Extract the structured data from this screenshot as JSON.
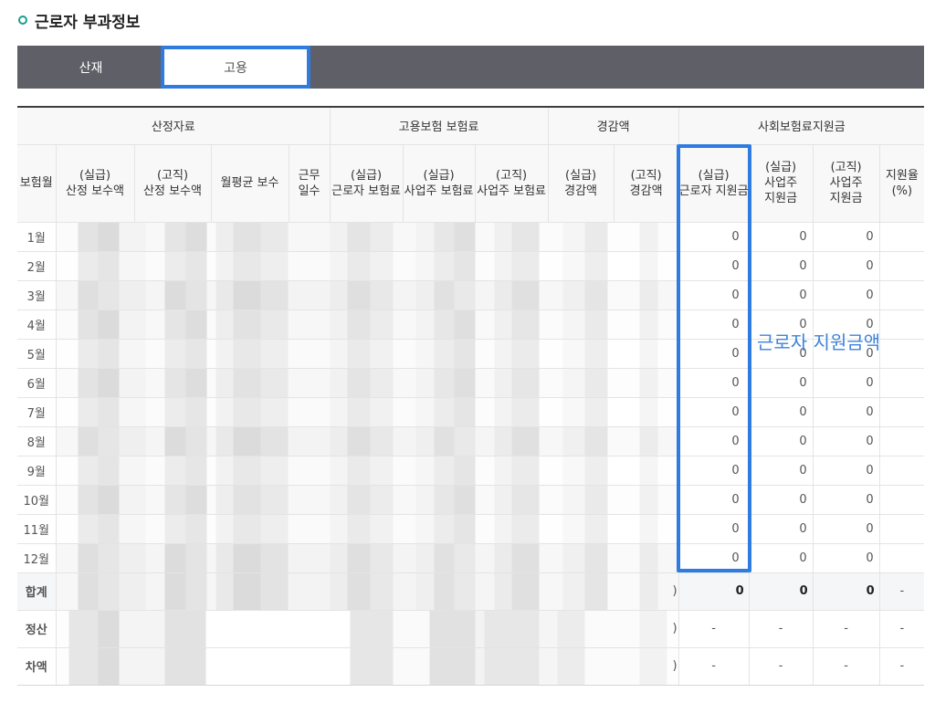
{
  "section": {
    "title": "근로자 부과정보"
  },
  "tabs": [
    {
      "label": "산재",
      "active": false
    },
    {
      "label": "고용",
      "active": true
    }
  ],
  "table": {
    "group_headers": [
      "산정자료",
      "고용보험 보험료",
      "경감액",
      "사회보험료지원금"
    ],
    "columns": [
      {
        "lines": [
          "보험월"
        ]
      },
      {
        "lines": [
          "(실급)",
          "산정 보수액"
        ]
      },
      {
        "lines": [
          "(고직)",
          "산정 보수액"
        ]
      },
      {
        "lines": [
          "월평균 보수"
        ]
      },
      {
        "lines": [
          "근무",
          "일수"
        ]
      },
      {
        "lines": [
          "(실급)",
          "근로자 보험료"
        ]
      },
      {
        "lines": [
          "(실급)",
          "사업주 보험료"
        ]
      },
      {
        "lines": [
          "(고직)",
          "사업주 보험료"
        ]
      },
      {
        "lines": [
          "(실급)",
          "경감액"
        ]
      },
      {
        "lines": [
          "(고직)",
          "경감액"
        ]
      },
      {
        "lines": [
          "(실급)",
          "근로자 지원금"
        ]
      },
      {
        "lines": [
          "(실급)",
          "사업주",
          "지원금"
        ]
      },
      {
        "lines": [
          "(고직)",
          "사업주",
          "지원금"
        ]
      },
      {
        "lines": [
          "지원율",
          "(%)"
        ]
      }
    ],
    "rows": [
      {
        "month": "1월",
        "worker_support": "0",
        "employer_support_silgeup": "0",
        "employer_support_gojik": "0",
        "support_rate": ""
      },
      {
        "month": "2월",
        "worker_support": "0",
        "employer_support_silgeup": "0",
        "employer_support_gojik": "0",
        "support_rate": ""
      },
      {
        "month": "3월",
        "worker_support": "0",
        "employer_support_silgeup": "0",
        "employer_support_gojik": "0",
        "support_rate": ""
      },
      {
        "month": "4월",
        "worker_support": "0",
        "employer_support_silgeup": "0",
        "employer_support_gojik": "0",
        "support_rate": ""
      },
      {
        "month": "5월",
        "worker_support": "0",
        "employer_support_silgeup": "0",
        "employer_support_gojik": "0",
        "support_rate": ""
      },
      {
        "month": "6월",
        "worker_support": "0",
        "employer_support_silgeup": "0",
        "employer_support_gojik": "0",
        "support_rate": ""
      },
      {
        "month": "7월",
        "worker_support": "0",
        "employer_support_silgeup": "0",
        "employer_support_gojik": "0",
        "support_rate": ""
      },
      {
        "month": "8월",
        "worker_support": "0",
        "employer_support_silgeup": "0",
        "employer_support_gojik": "0",
        "support_rate": ""
      },
      {
        "month": "9월",
        "worker_support": "0",
        "employer_support_silgeup": "0",
        "employer_support_gojik": "0",
        "support_rate": ""
      },
      {
        "month": "10월",
        "worker_support": "0",
        "employer_support_silgeup": "0",
        "employer_support_gojik": "0",
        "support_rate": ""
      },
      {
        "month": "11월",
        "worker_support": "0",
        "employer_support_silgeup": "0",
        "employer_support_gojik": "0",
        "support_rate": ""
      },
      {
        "month": "12월",
        "worker_support": "0",
        "employer_support_silgeup": "0",
        "employer_support_gojik": "0",
        "support_rate": ""
      }
    ],
    "summary": [
      {
        "label": "합계",
        "tail": ")",
        "worker_support": "0",
        "employer_support_silgeup": "0",
        "employer_support_gojik": "0",
        "support_rate": "-"
      },
      {
        "label": "정산",
        "tail": ")",
        "worker_support": "-",
        "employer_support_silgeup": "-",
        "employer_support_gojik": "-",
        "support_rate": "-"
      },
      {
        "label": "차액",
        "tail": ")",
        "worker_support": "-",
        "employer_support_silgeup": "-",
        "employer_support_gojik": "-",
        "support_rate": "-"
      }
    ]
  },
  "annotation": {
    "label": "근로자 지원금액",
    "color": "#2f7be0"
  },
  "colors": {
    "tab_bar": "#5f6067",
    "highlight": "#2f7be0",
    "bullet": "#1b9e8e",
    "annotation_text": "#3f83d9"
  }
}
